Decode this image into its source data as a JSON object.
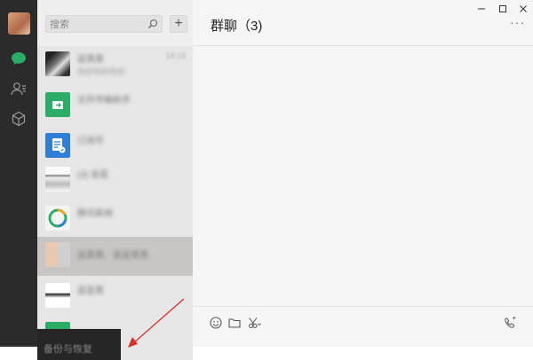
{
  "search": {
    "placeholder": "搜索"
  },
  "add_label": "+",
  "chat_list": [
    {
      "name": "蓝黄黄",
      "preview": "你好你好你好",
      "time": "18:18"
    },
    {
      "name": "文件传输助手",
      "preview": "",
      "time": ""
    },
    {
      "name": "订阅号",
      "preview": "",
      "time": ""
    },
    {
      "name": "(3) 金蓝",
      "preview": "",
      "time": ""
    },
    {
      "name": "腾讯新闻",
      "preview": "",
      "time": ""
    },
    {
      "name": "蓝黄黄、蓝蓝黄黄",
      "preview": "",
      "time": ""
    },
    {
      "name": "蓝蓝黄",
      "preview": "",
      "time": ""
    }
  ],
  "backup": {
    "label": "备份与恢复"
  },
  "chat": {
    "title": "群聊（3)"
  },
  "more_label": "···",
  "colors": {
    "accent": "#2aae67",
    "rail": "#2b2b2b",
    "selected": "#c7c6c5",
    "arrow": "#d9302c"
  }
}
